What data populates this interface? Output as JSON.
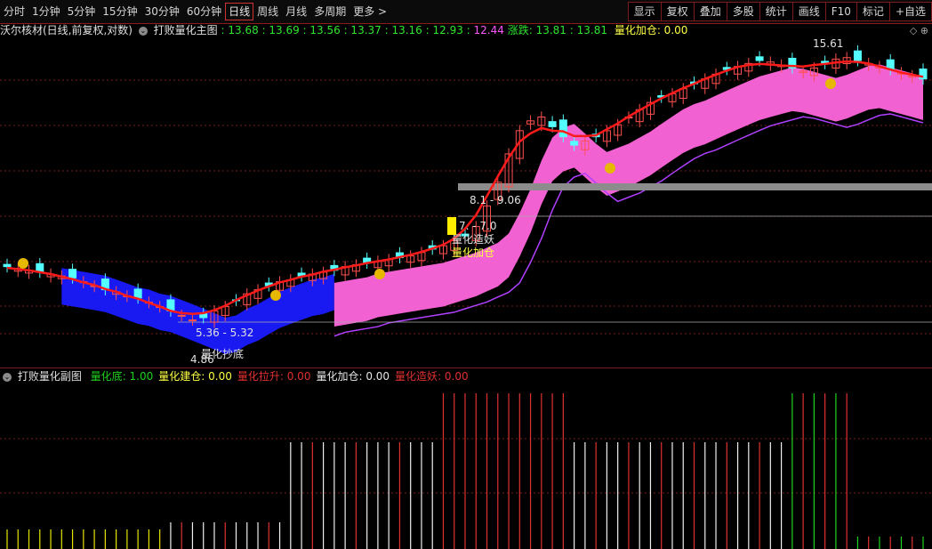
{
  "toolbar": {
    "periods": [
      "分时",
      "1分钟",
      "5分钟",
      "15分钟",
      "30分钟",
      "60分钟",
      "日线",
      "周线",
      "月线",
      "多周期",
      "更多 >"
    ],
    "active_period": "日线",
    "right_buttons": [
      "显示",
      "复权",
      "叠加",
      "多股",
      "统计",
      "画线",
      "F10",
      "标记",
      "+自选"
    ]
  },
  "main_legend": {
    "stock": "沃尔核材(日线,前复权,对数)",
    "indicator": "打败量化主图",
    "values": ": 13.68 : 13.69 : 13.56 : 13.37 : 13.16 : 12.93 :",
    "magenta_value": "12.44",
    "zhangdie_label": "涨跌",
    "zhangdie_values": ": 13.81 : 13.81",
    "jiacang_label": "量化加仓",
    "jiacang_value": ": 0.00"
  },
  "sub_legend": {
    "indicator": "打败量化副图",
    "items": [
      {
        "label": "量化底",
        "value": ": 1.00",
        "color": "#1fd11f"
      },
      {
        "label": "量化建仓",
        "value": ": 0.00",
        "color": "#ffff44"
      },
      {
        "label": "量化拉升",
        "value": ": 0.00",
        "color": "#e03030"
      },
      {
        "label": "量化加仓",
        "value": ": 0.00",
        "color": "#e6e6e6"
      },
      {
        "label": "量化造妖",
        "value": ": 0.00",
        "color": "#e03030"
      }
    ]
  },
  "chart_annotations": {
    "high_label": "15.61",
    "mid_level_label": "8.1 - 9.06",
    "low_level_label": "7. - 7.0",
    "low_range_label": "5.36 - 5.32",
    "low_price_label": "4.86",
    "chaodi_label": "量化抄底",
    "zaoyao_label": "量化造妖",
    "jiacang_label": "量化加仓"
  },
  "colors": {
    "up": "#ff5050",
    "down": "#54ffff",
    "trend_red": "#ff1a1a",
    "trend_green": "#00e000",
    "band_blue": "#1a1aff",
    "band_pink": "#ff66dd",
    "grid": "#7a1c1c"
  },
  "chart_data": {
    "type": "candlestick",
    "title": "沃尔核材(日线,前复权,对数)",
    "price_range": [
      4.86,
      15.61
    ],
    "closes": [
      6.2,
      6.15,
      6.1,
      6.05,
      6.0,
      5.95,
      5.9,
      5.8,
      5.7,
      5.6,
      5.55,
      5.45,
      5.4,
      5.3,
      5.2,
      5.1,
      5.0,
      4.9,
      4.95,
      5.1,
      5.2,
      5.35,
      5.5,
      5.6,
      5.7,
      5.8,
      5.85,
      5.95,
      6.0,
      6.05,
      6.1,
      6.2,
      6.25,
      6.3,
      6.35,
      6.4,
      6.45,
      6.5,
      6.6,
      6.7,
      6.8,
      6.95,
      7.1,
      7.4,
      8.1,
      9.0,
      10.2,
      11.3,
      11.8,
      12.0,
      11.5,
      11.0,
      10.6,
      10.8,
      11.0,
      11.3,
      11.6,
      12.0,
      12.4,
      12.8,
      13.1,
      13.3,
      13.6,
      13.9,
      14.2,
      14.5,
      14.8,
      15.0,
      15.2,
      15.4,
      15.3,
      15.1,
      14.9,
      14.7,
      14.9,
      15.2,
      15.5,
      15.6,
      15.4,
      15.2,
      15.0,
      14.8,
      14.6,
      14.4,
      14.2
    ],
    "sub_series": [
      {
        "name": "量化底",
        "type": "bar"
      },
      {
        "name": "量化建仓",
        "type": "bar"
      },
      {
        "name": "量化拉升",
        "type": "bar"
      },
      {
        "name": "量化加仓",
        "type": "bar"
      },
      {
        "name": "量化造妖",
        "type": "bar"
      }
    ]
  }
}
